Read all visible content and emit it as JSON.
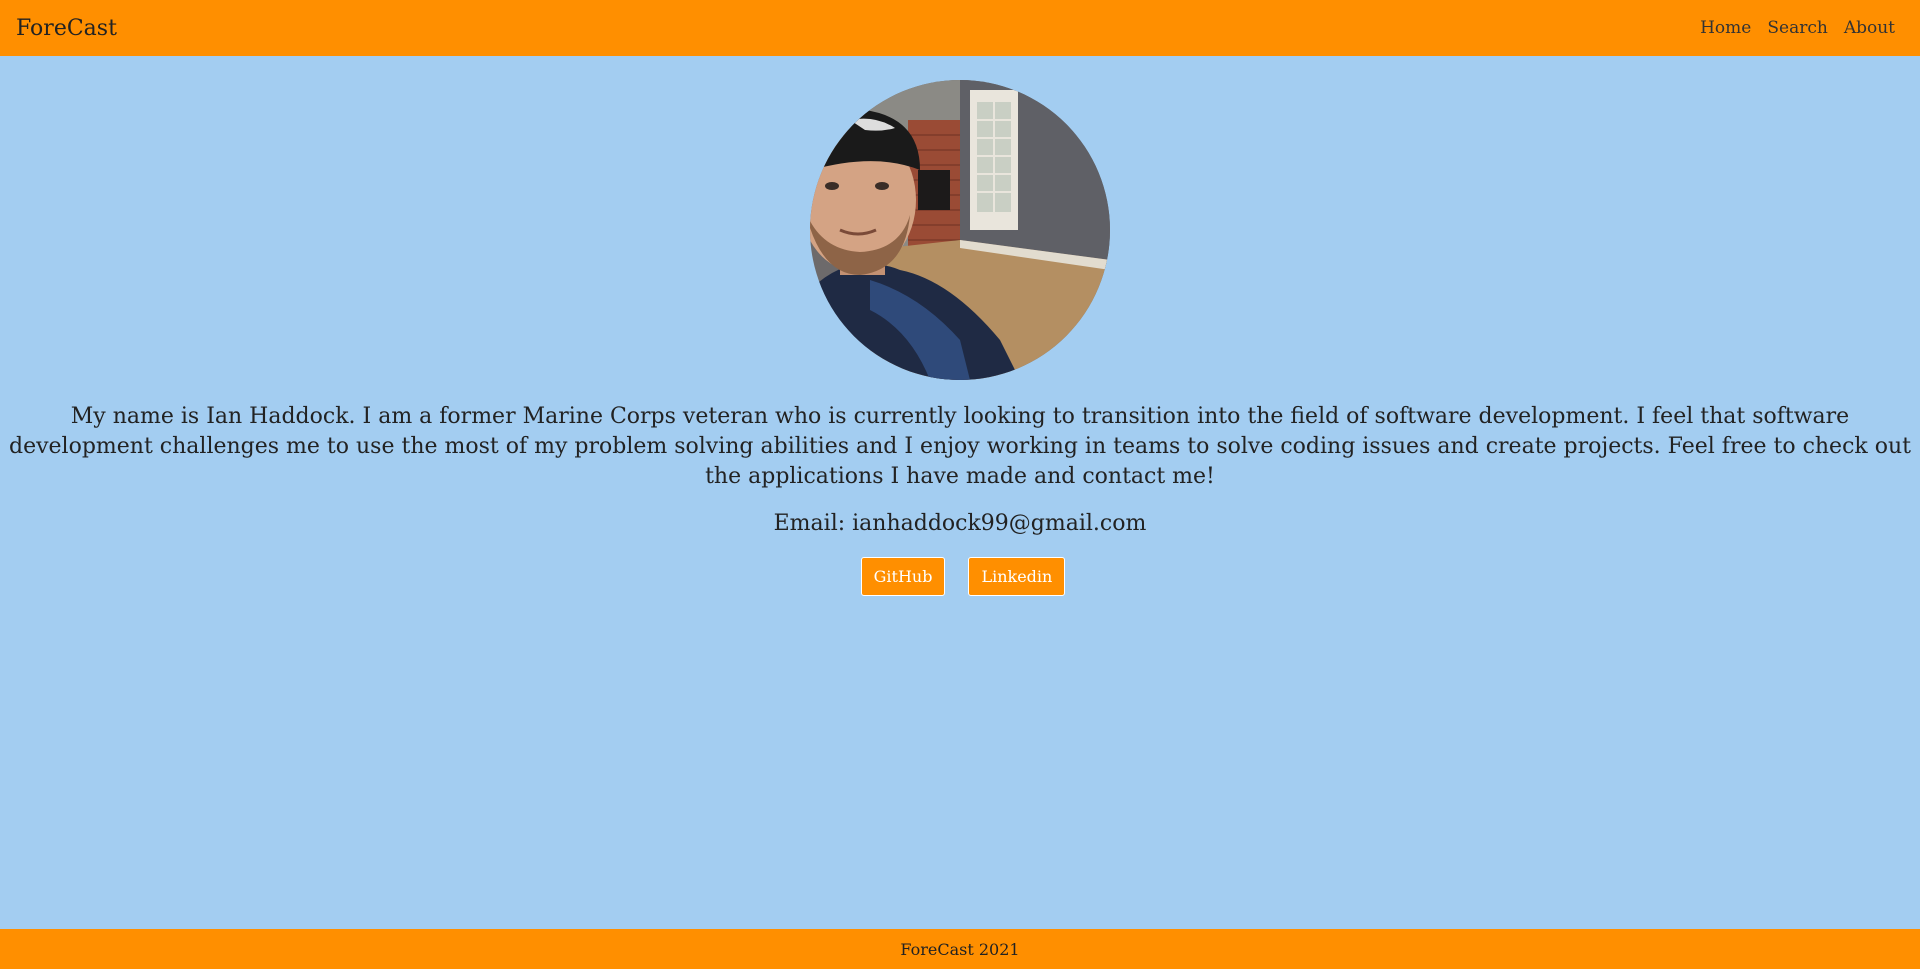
{
  "navbar": {
    "brand": "ForeCast",
    "links": [
      "Home",
      "Search",
      "About"
    ]
  },
  "profile": {
    "bio": "My name is Ian Haddock. I am a former Marine Corps veteran who is currently looking to transition into the field of software development. I feel that software development challenges me to use the most of my problem solving abilities and I enjoy working in teams to solve coding issues and create projects. Feel free to check out the applications I have made and contact me!",
    "email": "Email: ianhaddock99@gmail.com",
    "buttons": {
      "github": "GitHub",
      "linkedin": "Linkedin"
    }
  },
  "footer": {
    "text": "ForeCast 2021"
  },
  "colors": {
    "accent": "#ff8f00",
    "background": "#a3cdf1"
  }
}
